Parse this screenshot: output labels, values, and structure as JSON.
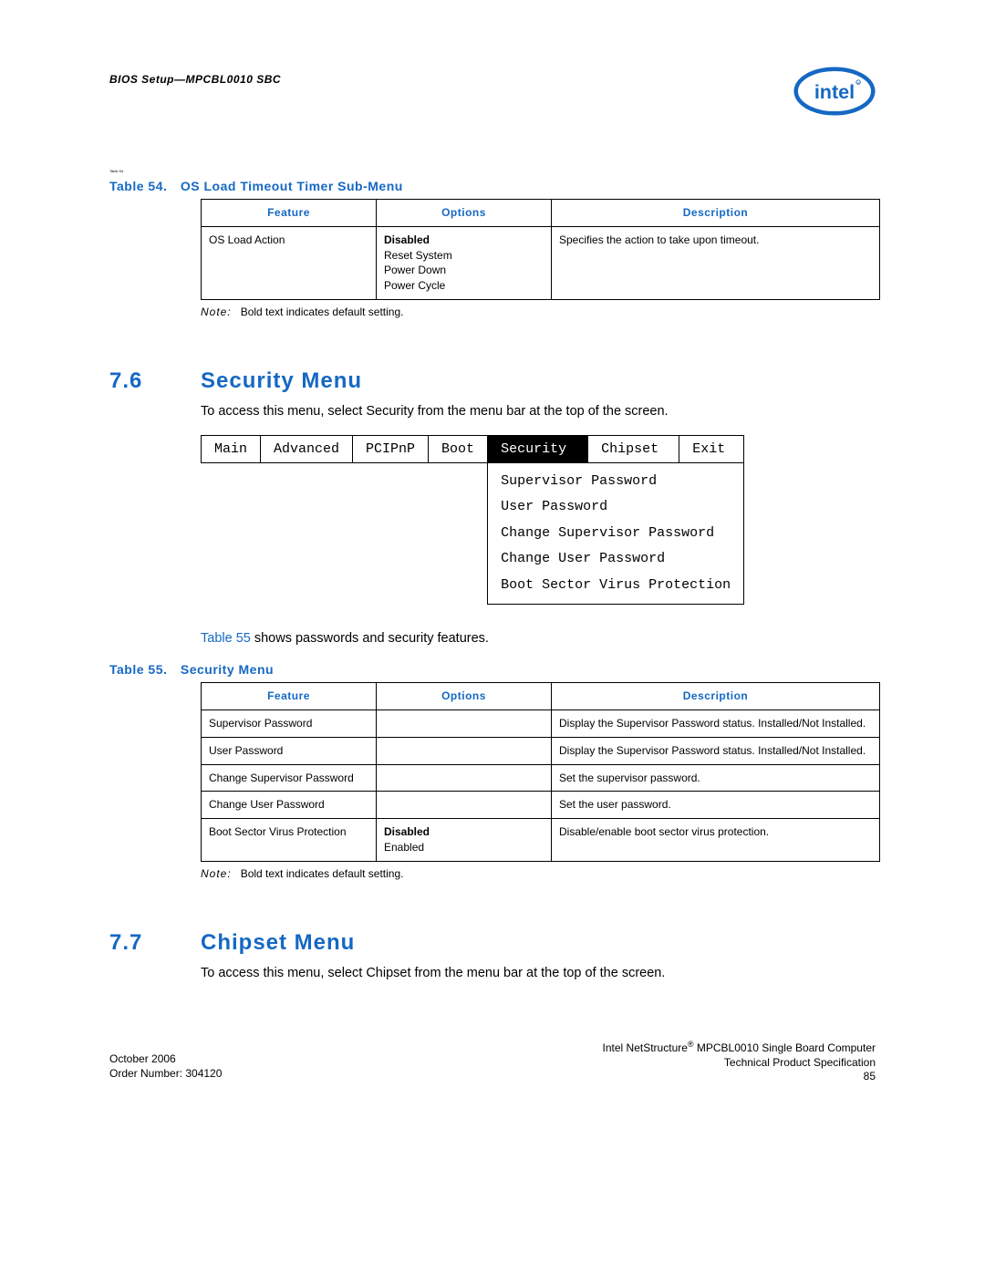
{
  "header": {
    "doc_title": "BIOS Setup—MPCBL0010 SBC",
    "logo_alt": "intel"
  },
  "tiny_ref": "Table 54",
  "table54": {
    "caption": "Table 54. OS Load Timeout Timer Sub-Menu",
    "headers": {
      "feature": "Feature",
      "options": "Options",
      "desc": "Description"
    },
    "row": {
      "feature": "OS Load Action",
      "opt_bold": "Disabled",
      "opt2": "Reset System",
      "opt3": "Power Down",
      "opt4": "Power Cycle",
      "desc": "Specifies the action to take upon timeout."
    },
    "note_label": "Note:",
    "note_text": "Bold text indicates default setting."
  },
  "section76": {
    "num": "7.6",
    "title": "Security Menu",
    "para": "To access this menu, select Security from the menu bar at the top of the screen.",
    "menu": {
      "tabs": [
        "Main",
        "Advanced",
        "PCIPnP",
        "Boot",
        "Security",
        "Chipset",
        "Exit"
      ],
      "items_text": "Supervisor Password\nUser Password\nChange Supervisor Password\nChange User Password\nBoot Sector Virus Protection"
    },
    "para2_link": "Table 55",
    "para2_rest": " shows passwords and security features."
  },
  "table55": {
    "caption": "Table 55. Security Menu",
    "headers": {
      "feature": "Feature",
      "options": "Options",
      "desc": "Description"
    },
    "rows": [
      {
        "feature": "Supervisor Password",
        "options": "",
        "desc": "Display the Supervisor Password status. Installed/Not Installed."
      },
      {
        "feature": "User Password",
        "options": "",
        "desc": "Display the Supervisor Password status. Installed/Not Installed."
      },
      {
        "feature": "Change Supervisor Password",
        "options": "",
        "desc": "Set the supervisor password."
      },
      {
        "feature": "Change User Password",
        "options": "",
        "desc": "Set the user password."
      }
    ],
    "row_boot": {
      "feature": "Boot Sector Virus Protection",
      "opt_bold": "Disabled",
      "opt2": "Enabled",
      "desc": "Disable/enable boot sector virus protection."
    },
    "note_label": "Note:",
    "note_text": "Bold text indicates default setting."
  },
  "section77": {
    "num": "7.7",
    "title": "Chipset Menu",
    "para": "To access this menu, select Chipset from the menu bar at the top of the screen."
  },
  "footer": {
    "left1": "October 2006",
    "left2": "Order Number: 304120",
    "right1_pre": "Intel NetStructure",
    "right1_sup": "®",
    "right1_post": " MPCBL0010 Single Board Computer",
    "right2": "Technical Product Specification",
    "right3": "85"
  }
}
